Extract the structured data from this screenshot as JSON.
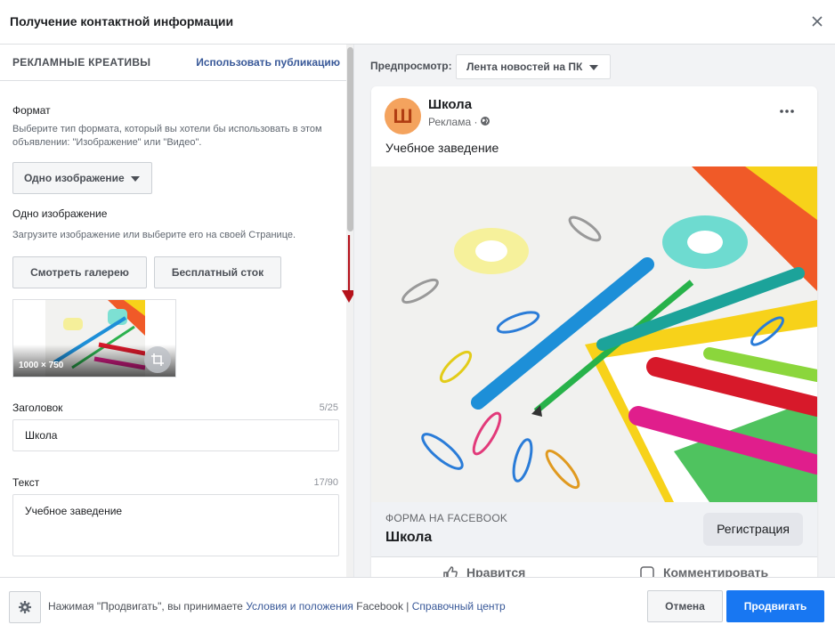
{
  "dialog": {
    "title": "Получение контактной информации",
    "close_icon": "close-icon"
  },
  "left": {
    "section_title": "РЕКЛАМНЫЕ КРЕАТИВЫ",
    "use_post_link": "Использовать публикацию",
    "format": {
      "label": "Формат",
      "help": "Выберите тип формата, который вы хотели бы использовать в этом объявлении: \"Изображение\" или \"Видео\".",
      "selected": "Одно изображение"
    },
    "single_image": {
      "label": "Одно изображение",
      "help": "Загрузите изображение или выберите его на своей Странице.",
      "gallery_button": "Смотреть галерею",
      "stock_button": "Бесплатный сток",
      "thumbnail_size": "1000 × 750"
    },
    "headline": {
      "label": "Заголовок",
      "counter": "5/25",
      "value": "Школа"
    },
    "body_text": {
      "label": "Текст",
      "counter": "17/90",
      "value": "Учебное заведение"
    }
  },
  "preview": {
    "label": "Предпросмотр:",
    "placement": "Лента новостей на ПК",
    "post": {
      "avatar_letter": "Ш",
      "page_name": "Школа",
      "sponsored": "Реклама ·",
      "text": "Учебное заведение",
      "cta_caption": "ФОРМА НА FACEBOOK",
      "cta_headline": "Школа",
      "cta_button": "Регистрация",
      "like": "Нравится",
      "comment": "Комментировать"
    }
  },
  "footer": {
    "text_before": "Нажимая \"Продвигать\", вы принимаете",
    "terms_link": "Условия и положения",
    "text_after": "Facebook  |",
    "help_link": "Справочный центр",
    "cancel": "Отмена",
    "promote": "Продвигать"
  },
  "colors": {
    "primary": "#1877f2",
    "link": "#385898",
    "annotation_arrow": "#b5121b"
  }
}
